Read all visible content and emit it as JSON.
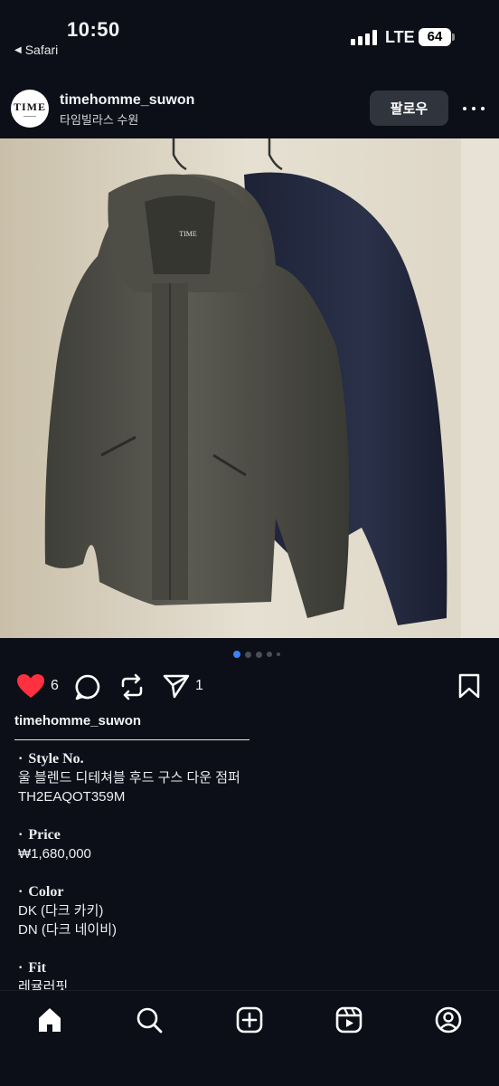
{
  "status_bar": {
    "time": "10:50",
    "back_app": "Safari",
    "network": "LTE",
    "battery": "64"
  },
  "post": {
    "username": "timehomme_suwon",
    "location": "타임빌라스 수원",
    "avatar_logo": "TIME",
    "follow_label": "팔로우",
    "likes": "6",
    "shares": "1",
    "carousel": {
      "count": 5,
      "active_index": 0
    },
    "liked": true
  },
  "caption": {
    "username": "timehomme_suwon",
    "sections": [
      {
        "title": "Style No.",
        "lines": [
          "울 블렌드 디테쳐블 후드 구스 다운 점퍼",
          "TH2EAQOT359M"
        ]
      },
      {
        "title": "Price",
        "lines": [
          "₩1,680,000"
        ]
      },
      {
        "title": "Color",
        "lines": [
          "DK (다크 카키)",
          "DN (다크 네이비)"
        ]
      },
      {
        "title": "Fit",
        "lines": [
          "레귤러핏"
        ]
      }
    ]
  },
  "icons": {
    "like": "heart-icon",
    "comment": "comment-icon",
    "repost": "repost-icon",
    "share": "send-icon",
    "save": "bookmark-icon",
    "nav": [
      "home-icon",
      "search-icon",
      "create-icon",
      "reels-icon",
      "profile-icon"
    ]
  },
  "colors": {
    "background": "#0c0f17",
    "like": "#ff3040",
    "active_dot": "#3b82f6"
  }
}
